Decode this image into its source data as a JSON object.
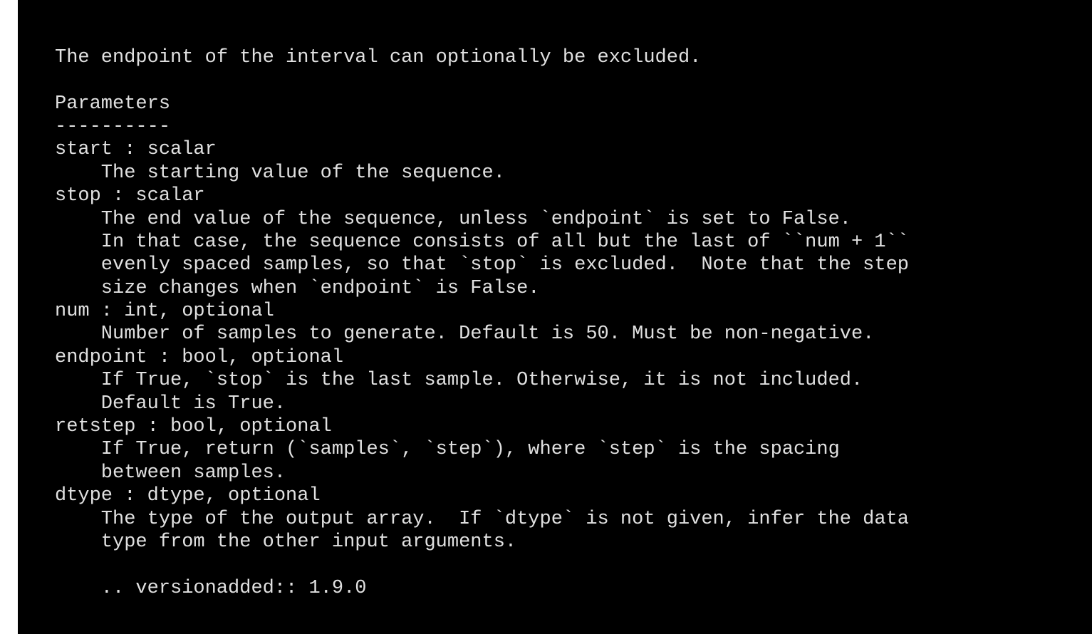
{
  "doc": {
    "lines": [
      "",
      "The endpoint of the interval can optionally be excluded.",
      "",
      "Parameters",
      "----------",
      "start : scalar",
      "    The starting value of the sequence.",
      "stop : scalar",
      "    The end value of the sequence, unless `endpoint` is set to False.",
      "    In that case, the sequence consists of all but the last of ``num + 1``",
      "    evenly spaced samples, so that `stop` is excluded.  Note that the step",
      "    size changes when `endpoint` is False.",
      "num : int, optional",
      "    Number of samples to generate. Default is 50. Must be non-negative.",
      "endpoint : bool, optional",
      "    If True, `stop` is the last sample. Otherwise, it is not included.",
      "    Default is True.",
      "retstep : bool, optional",
      "    If True, return (`samples`, `step`), where `step` is the spacing",
      "    between samples.",
      "dtype : dtype, optional",
      "    The type of the output array.  If `dtype` is not given, infer the data",
      "    type from the other input arguments.",
      "",
      "    .. versionadded:: 1.9.0"
    ]
  }
}
